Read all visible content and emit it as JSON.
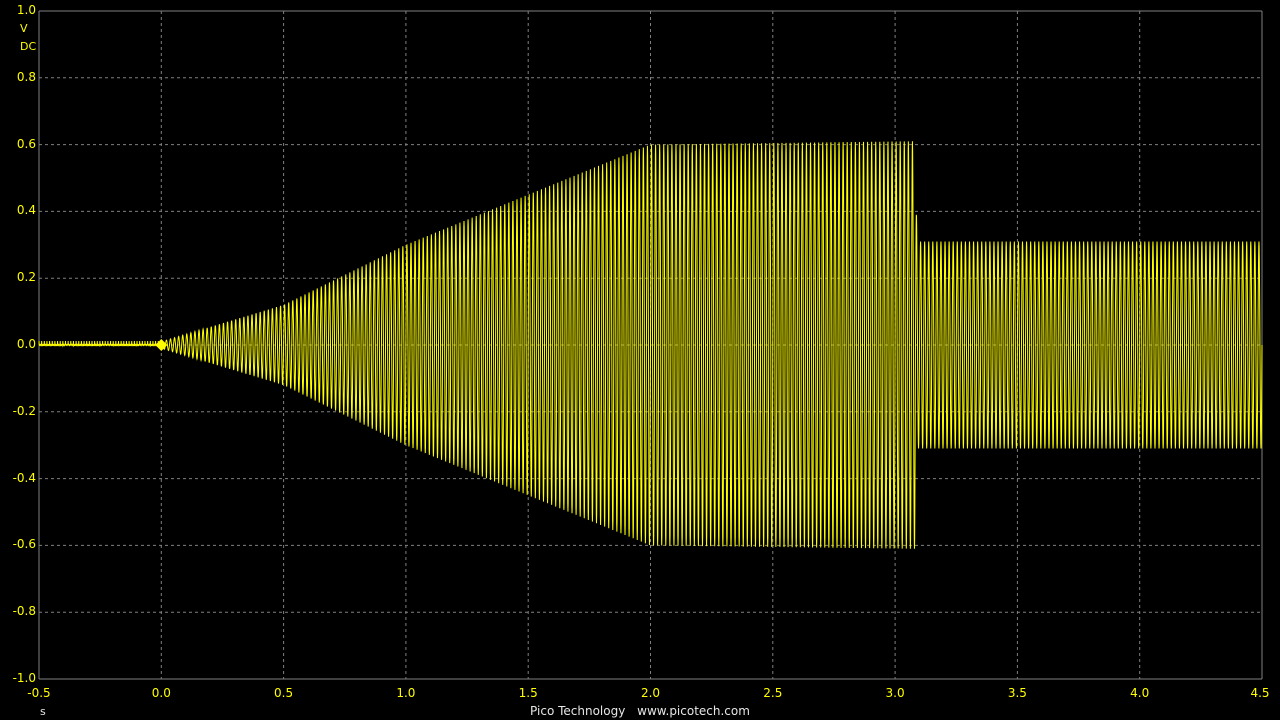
{
  "app": {
    "footer_brand": "Pico Technology",
    "footer_url": "www.picotech.com"
  },
  "channel": {
    "y_unit": "V",
    "coupling": "DC",
    "x_unit": "s",
    "trace_color": "#ffff00",
    "grid_color": "#808080",
    "background_color": "#000000"
  },
  "chart_data": {
    "type": "line",
    "title": "",
    "xlabel": "s",
    "ylabel": "V",
    "xlim": [
      -0.5,
      4.5
    ],
    "ylim": [
      -1.0,
      1.0
    ],
    "grid": true,
    "x_ticks": [
      "-0.5",
      "0.0",
      "0.5",
      "1.0",
      "1.5",
      "2.0",
      "2.5",
      "3.0",
      "3.5",
      "4.0",
      "4.5"
    ],
    "y_ticks": [
      "1.0",
      "0.8",
      "0.6",
      "0.4",
      "0.2",
      "0.0",
      "-0.2",
      "-0.4",
      "-0.6",
      "-0.8",
      "-1.0"
    ],
    "trigger_marker": {
      "x": 0.0,
      "y": 0.0
    },
    "envelope": [
      {
        "x": -0.5,
        "amp": 0.01
      },
      {
        "x": 0.0,
        "amp": 0.01
      },
      {
        "x": 0.5,
        "amp": 0.12
      },
      {
        "x": 1.0,
        "amp": 0.3
      },
      {
        "x": 1.5,
        "amp": 0.45
      },
      {
        "x": 2.0,
        "amp": 0.6
      },
      {
        "x": 3.08,
        "amp": 0.61
      },
      {
        "x": 3.09,
        "amp": 0.31
      },
      {
        "x": 4.5,
        "amp": 0.31
      }
    ],
    "series": [
      {
        "name": "",
        "description_cycles_per_second": 60
      }
    ]
  }
}
